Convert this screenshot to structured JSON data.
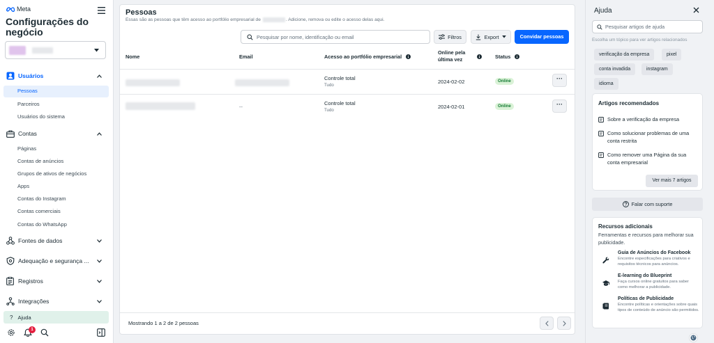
{
  "brand": {
    "logo_text": "Meta"
  },
  "sidebar": {
    "title": "Configurações do negócio",
    "sections": {
      "usuarios": {
        "label": "Usuários",
        "items": [
          "Pessoas",
          "Parceiros",
          "Usuários do sistema"
        ]
      },
      "contas": {
        "label": "Contas",
        "items": [
          "Páginas",
          "Contas de anúncios",
          "Grupos de ativos de negócios",
          "Apps",
          "Contas do Instagram",
          "Contas comerciais",
          "Contas do WhatsApp"
        ]
      },
      "fontes": {
        "label": "Fontes de dados"
      },
      "adequacao": {
        "label": "Adequação e segurança ..."
      },
      "registros": {
        "label": "Registros"
      },
      "integracoes": {
        "label": "Integrações"
      }
    },
    "help_label": "Ajuda",
    "notification_count": "1"
  },
  "main": {
    "title": "Pessoas",
    "subtitle_before": "Essas são as pessoas que têm acesso ao portfólio empresarial de",
    "subtitle_after": ". Adicione, remova ou edite o acesso delas aqui.",
    "search_placeholder": "Pesquisar por nome, identificação ou email",
    "filters_label": "Filtros",
    "export_label": "Export",
    "invite_label": "Convidar pessoas",
    "columns": {
      "name": "Nome",
      "email": "Email",
      "access": "Acesso ao portfólio empresarial",
      "online": "Online pela última vez",
      "status": "Status"
    },
    "rows": [
      {
        "email": "",
        "access": "Controle total",
        "access_sub": "Tudo",
        "last_online": "2024-02-02",
        "status": "Online"
      },
      {
        "email": "--",
        "access": "Controle total",
        "access_sub": "Tudo",
        "last_online": "2024-02-01",
        "status": "Online"
      }
    ],
    "footer": "Mostrando 1 a 2 de 2 pessoas"
  },
  "help": {
    "title": "Ajuda",
    "search_placeholder": "Pesquisar artigos de ajuda",
    "topic_hint": "Escolha um tópico para ver artigos relacionados",
    "chips": [
      "verificação da empresa",
      "pixel",
      "conta invadida",
      "instagram",
      "idioma"
    ],
    "recommended_title": "Artigos recomendados",
    "articles": [
      "Sobre a verificação da empresa",
      "Como solucionar problemas de uma conta restrita",
      "Como remover uma Página da sua conta empresarial"
    ],
    "see_more": "Ver mais 7 artigos",
    "support_label": "Falar com suporte",
    "resources_title": "Recursos adicionais",
    "resources_sub": "Ferramentas e recursos para melhorar sua publicidade.",
    "resources": [
      {
        "title": "Guia de Anúncios do Facebook",
        "desc": "Encontre especificações para criativos e requisitos técnicos para anúncios."
      },
      {
        "title": "E-learning do Blueprint",
        "desc": "Faça cursos online gratuitos para saber como melhorar a publicidade."
      },
      {
        "title": "Políticas de Publicidade",
        "desc": "Encontre políticas e orientações sobre quais tipos de conteúdo de anúncio são permitidos."
      }
    ]
  },
  "colors": {
    "accent": "#0866ff",
    "online_bg": "#daf2d7",
    "online_text": "#127a32",
    "selected_bg": "#e7f0fd",
    "help_active_bg": "#e0f1ea"
  }
}
